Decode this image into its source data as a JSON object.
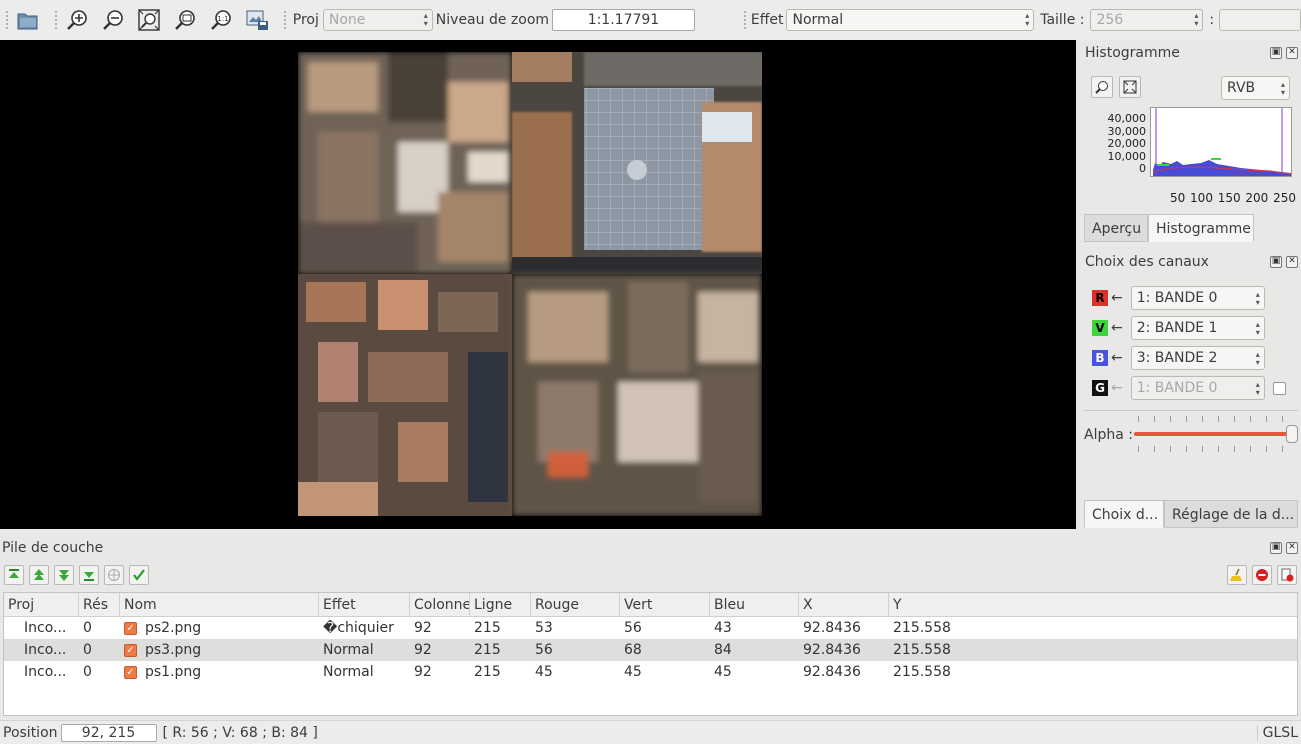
{
  "toolbar": {
    "proj_label": "Proj",
    "proj_value": "None",
    "zoom_label": "Niveau de zoom",
    "zoom_value": "1:1.17791",
    "effect_label": "Effet",
    "effect_value": "Normal",
    "size_label": "Taille :",
    "size_value": "256",
    "size_sep": ":",
    "size_value2": ""
  },
  "histogram_panel": {
    "title": "Histogramme",
    "mode": "RVB",
    "y_ticks": [
      "40,000",
      "30,000",
      "20,000",
      "10,000",
      "0"
    ],
    "x_ticks": [
      "50",
      "100",
      "150",
      "200",
      "250"
    ],
    "tabs": [
      "Aperçu",
      "Histogramme"
    ]
  },
  "channels_panel": {
    "title": "Choix des canaux",
    "channels": [
      {
        "letter": "R",
        "color": "#e0302a",
        "value": "1: BANDE 0",
        "enabled": true
      },
      {
        "letter": "V",
        "color": "#3cd63c",
        "value": "2: BANDE 1",
        "enabled": true
      },
      {
        "letter": "B",
        "color": "#4a52e0",
        "value": "3: BANDE 2",
        "enabled": true
      },
      {
        "letter": "G",
        "color": "#111111",
        "value": "1: BANDE 0",
        "enabled": false
      }
    ],
    "alpha_label": "Alpha :",
    "alpha_value": 1.0,
    "bottom_tabs": [
      "Choix d...",
      "Réglage de la d..."
    ]
  },
  "layer_stack": {
    "title": "Pile de couche",
    "columns": [
      "Proj",
      "Rés",
      "Nom",
      "Effet",
      "Colonne",
      "Ligne",
      "Rouge",
      "Vert",
      "Bleu",
      "X",
      "Y"
    ],
    "rows": [
      {
        "proj": "Inco...",
        "res": "0",
        "name": "ps2.png",
        "effect": "�chiquier",
        "col": "92",
        "line": "215",
        "red": "53",
        "green": "56",
        "blue": "43",
        "x": "92.8436",
        "y": "215.558",
        "selected": false
      },
      {
        "proj": "Inco...",
        "res": "0",
        "name": "ps3.png",
        "effect": "Normal",
        "col": "92",
        "line": "215",
        "red": "56",
        "green": "68",
        "blue": "84",
        "x": "92.8436",
        "y": "215.558",
        "selected": true
      },
      {
        "proj": "Inco...",
        "res": "0",
        "name": "ps1.png",
        "effect": "Normal",
        "col": "92",
        "line": "215",
        "red": "45",
        "green": "45",
        "blue": "45",
        "x": "92.8436",
        "y": "215.558",
        "selected": false
      }
    ]
  },
  "status": {
    "position_label": "Position",
    "position_value": "92, 215",
    "pixel_value": "[ R: 56 ; V: 68 ; B: 84 ]",
    "renderer": "GLSL"
  }
}
